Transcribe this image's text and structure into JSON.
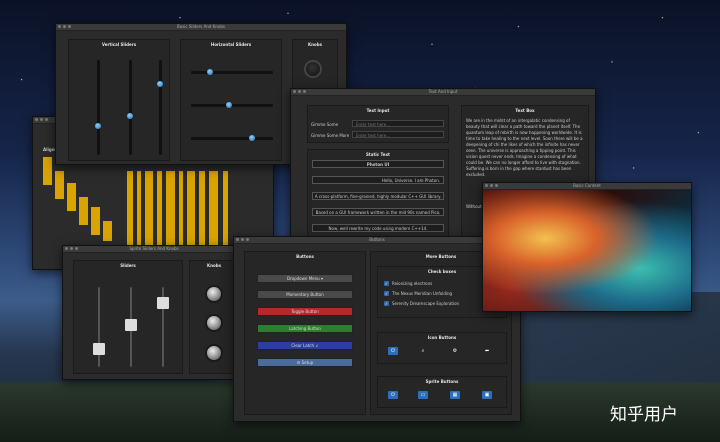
{
  "windows": {
    "sliders": {
      "title": "Basic Sliders And Knobs",
      "vertical_title": "Vertical Sliders",
      "horizontal_title": "Horizontal Sliders",
      "knobs_title": "Knobs"
    },
    "text": {
      "title": "Text And Input",
      "text_input_title": "Text Input",
      "field1_label": "Gimme Some",
      "field1_placeholder": "Enter text here...",
      "field2_label": "Gimme Some More",
      "field2_placeholder": "Enter text here...",
      "static_title": "Static Text",
      "static_lines": [
        "Photon UI",
        "Hello, Universe. I am Photon.",
        "A cross-platform, fine-grained, highly modular C++ GUI library.",
        "Based on a GUI framework written in the mid 90s named Pica.",
        "Now, well rewrite my code using modern C++14."
      ],
      "textbox_title": "Text Box",
      "textbox_body": "We are in the midst of an intergalatic condensing of beauty that will clear a path toward the planet itself. The quantum leap of rebirth is now happening worldwide. It is time to take healing to the next level. Soon there will be a deepening of chi the likes of which the infinite has never seen. The universe is approaching a tipping point. This vision quest never ends. Imagine a condensing of what could be. We can no longer afford to live with stagnation. Suffering is born in the gap where stardust has been excluded.",
      "textbox_tail": "Without ... Stagna... seeker... entity... The te... outsid..."
    },
    "sprite_sliders": {
      "title": "Sprite Sliders And Knobs",
      "sliders_title": "Sliders",
      "knobs_title": "Knobs"
    },
    "buttons": {
      "title": "Buttons",
      "buttons_title": "Buttons",
      "more_title": "More Buttons",
      "dropdown": "Dropdown Menu",
      "momentary": "Momentary Button",
      "toggle": "Toggle Button",
      "latching": "Latching Button",
      "clear_latch": "Clear Latch",
      "setup": "Setup",
      "checkboxes_title": "Check boxes",
      "checkboxes": [
        "Reionizing electrons",
        "The Nexus Meridian Unfolding",
        "Serenity Dreamscape Exploration"
      ],
      "icon_title": "Icon Buttons",
      "sprite_title": "Sprite Buttons"
    },
    "image": {
      "title": "Basic Content"
    },
    "bars": {
      "title": "Alignment"
    }
  },
  "watermark": "知乎用户",
  "colors": {
    "accent": "#2c6ec0",
    "toggle": "#b32a2a",
    "latching": "#2f7d2f",
    "clear": "#2a3fa0",
    "bars": "#d9a400"
  }
}
